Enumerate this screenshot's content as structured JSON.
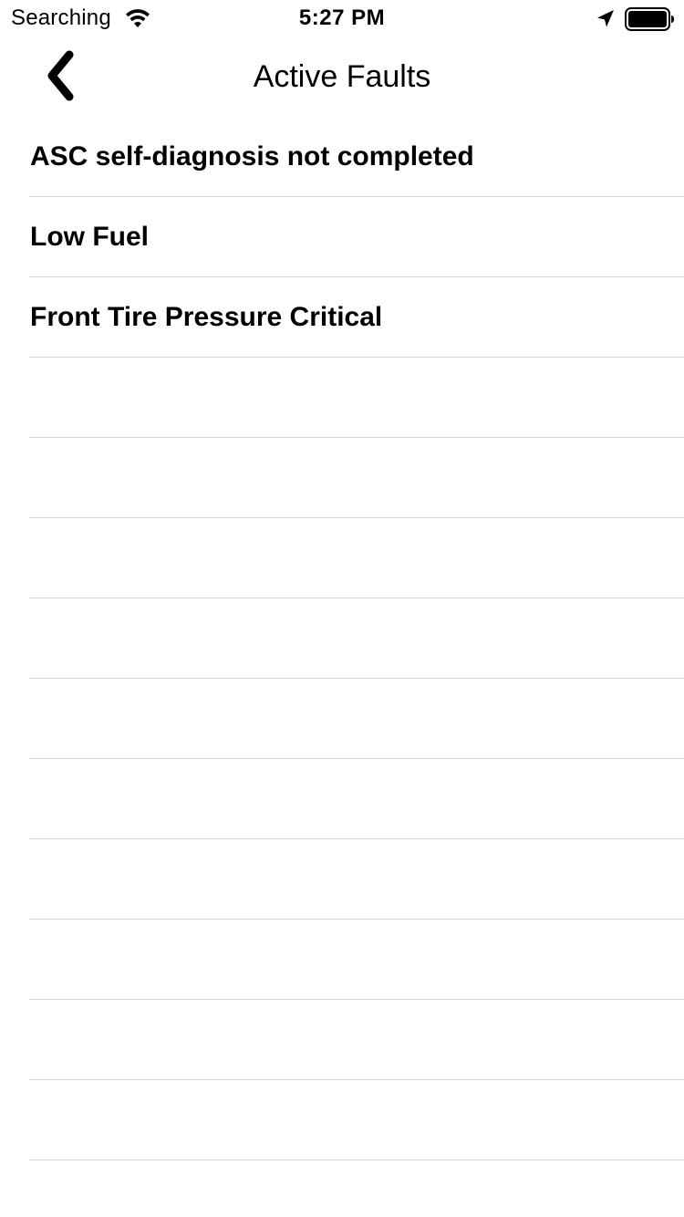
{
  "status_bar": {
    "carrier": "Searching",
    "time": "5:27 PM",
    "icons": [
      "wifi-icon",
      "location-icon",
      "battery-icon"
    ]
  },
  "nav": {
    "back_icon": "chevron-left-icon",
    "title": "Active Faults"
  },
  "faults": [
    {
      "label": "ASC self-diagnosis not completed"
    },
    {
      "label": "Low Fuel"
    },
    {
      "label": "Front Tire Pressure Critical"
    },
    {
      "label": ""
    },
    {
      "label": ""
    },
    {
      "label": ""
    },
    {
      "label": ""
    },
    {
      "label": ""
    },
    {
      "label": ""
    },
    {
      "label": ""
    },
    {
      "label": ""
    },
    {
      "label": ""
    },
    {
      "label": ""
    }
  ],
  "colors": {
    "text": "#000000",
    "separator": "#d6d6d6",
    "background": "#ffffff"
  }
}
